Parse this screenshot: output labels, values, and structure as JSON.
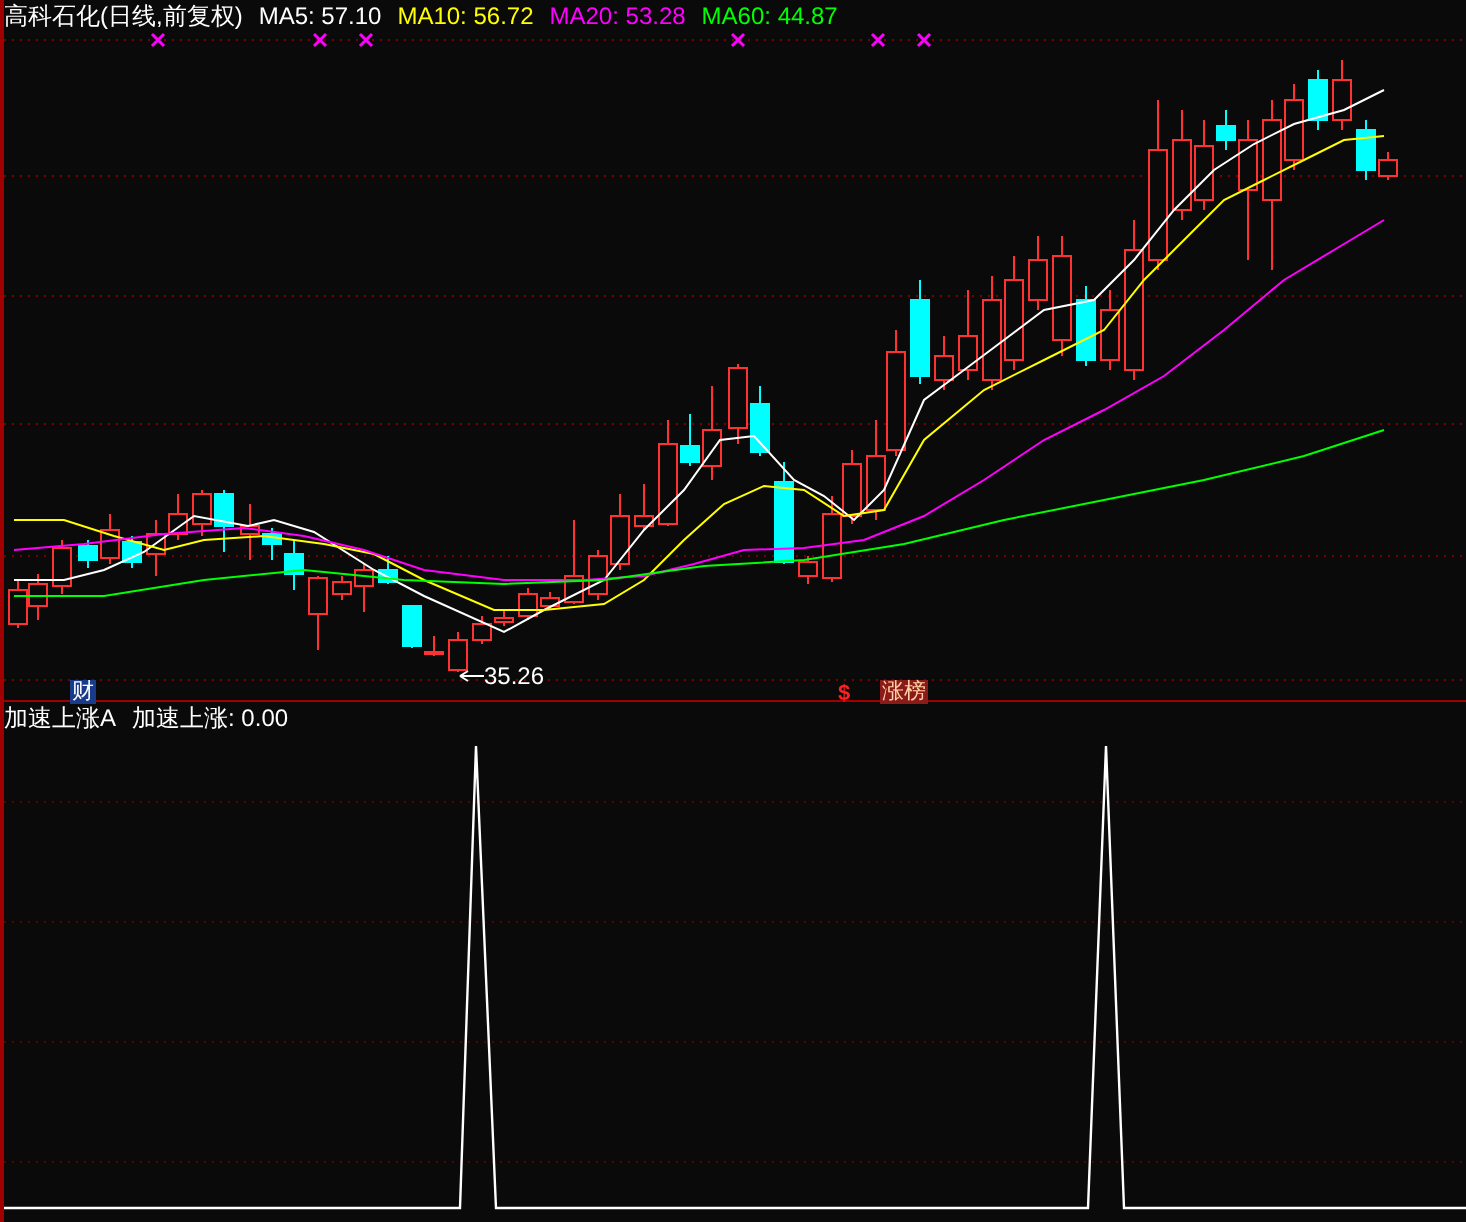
{
  "chart": {
    "title": "高科石化(日线,前复权)",
    "ma_legend": [
      {
        "label": "MA5: 57.10",
        "color": "#ffffff"
      },
      {
        "label": "MA10: 56.72",
        "color": "#ffff00"
      },
      {
        "label": "MA20: 53.28",
        "color": "#ff00ff"
      },
      {
        "label": "MA60: 44.87",
        "color": "#00ff00"
      }
    ],
    "low_price_label": "35.26",
    "badges": [
      {
        "kind": "finance",
        "text": "财"
      },
      {
        "kind": "dollar",
        "text": "$"
      },
      {
        "kind": "ranking",
        "text": "涨榜"
      }
    ]
  },
  "indicator": {
    "name": "加速上涨A",
    "reading": "加速上涨: 0.00"
  }
}
